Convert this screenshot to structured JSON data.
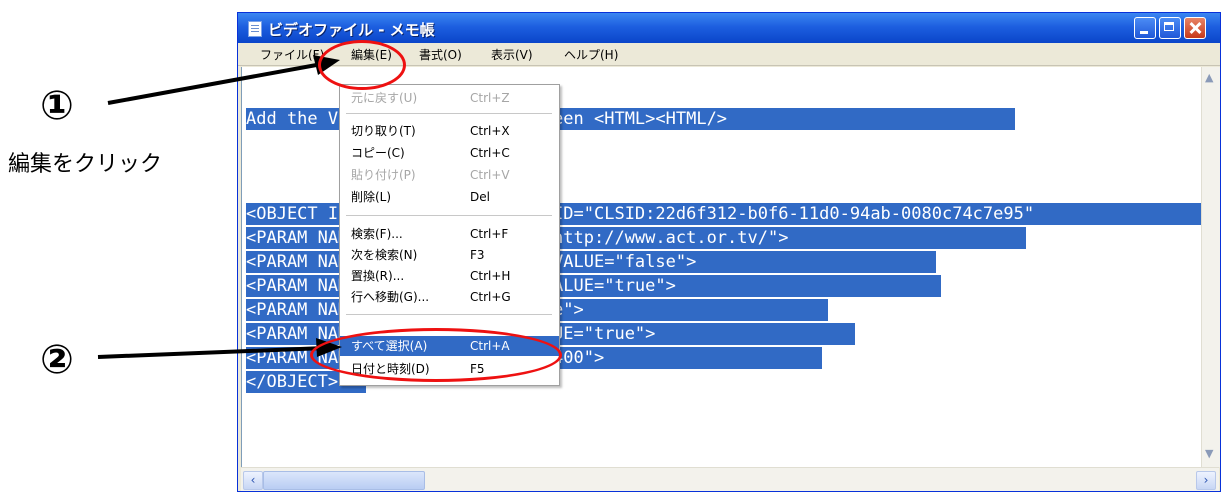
{
  "annotations": {
    "step1_number": "①",
    "step1_caption": "編集をクリック",
    "step2_number": "②"
  },
  "window": {
    "title": "ビデオファイル - メモ帳",
    "menu": [
      "ファイル(F)",
      "編集(E)",
      "書式(O)",
      "表示(V)",
      "ヘルプ(H)"
    ]
  },
  "editor": {
    "lines": [
      "Add the Visitor's Website between <HTML><HTML/>",
      "",
      "",
      "<OBJECT ID=\"MediaPlayer\" CLASSID=\"CLSID:22d6f312-b0f6-11d0-94ab-0080c74c7e95\"",
      "<PARAM NAME=\"FileName\" VALUE=\"http://www.act.or.tv/\">",
      "<PARAM NAME=\"AutoFormatStart\" VALUE=\"false\">",
      "<PARAM NAME=\"PresentatStart\" VALUE=\"true\">",
      "<PARAM NAME=\"Mute\" VALUE=\"false\">",
      "<PARAM NAME=\"ShowControls\" VALUE=\"true\">",
      "<PARAM NAME=\"FontSize\" VALUE=\"400\">",
      "</OBJECT>"
    ]
  },
  "edit_menu": {
    "items": [
      {
        "label": "元に戻す(U)",
        "shortcut": "Ctrl+Z",
        "disabled": true
      },
      {
        "label": "切り取り(T)",
        "shortcut": "Ctrl+X",
        "disabled": false
      },
      {
        "label": "コピー(C)",
        "shortcut": "Ctrl+C",
        "disabled": false
      },
      {
        "label": "貼り付け(P)",
        "shortcut": "Ctrl+V",
        "disabled": true
      },
      {
        "label": "削除(L)",
        "shortcut": "Del",
        "disabled": false
      },
      {
        "label": "検索(F)...",
        "shortcut": "Ctrl+F",
        "disabled": false
      },
      {
        "label": "次を検索(N)",
        "shortcut": "F3",
        "disabled": false
      },
      {
        "label": "置換(R)...",
        "shortcut": "Ctrl+H",
        "disabled": false
      },
      {
        "label": "行へ移動(G)...",
        "shortcut": "Ctrl+G",
        "disabled": false
      },
      {
        "label": "すべて選択(A)",
        "shortcut": "Ctrl+A",
        "disabled": false,
        "highlighted": true
      },
      {
        "label": "日付と時刻(D)",
        "shortcut": "F5",
        "disabled": false
      }
    ]
  },
  "colors": {
    "highlight_ellipse": "#ee1111",
    "selection": "#316ac5",
    "titlebar": "#0a45c9"
  }
}
